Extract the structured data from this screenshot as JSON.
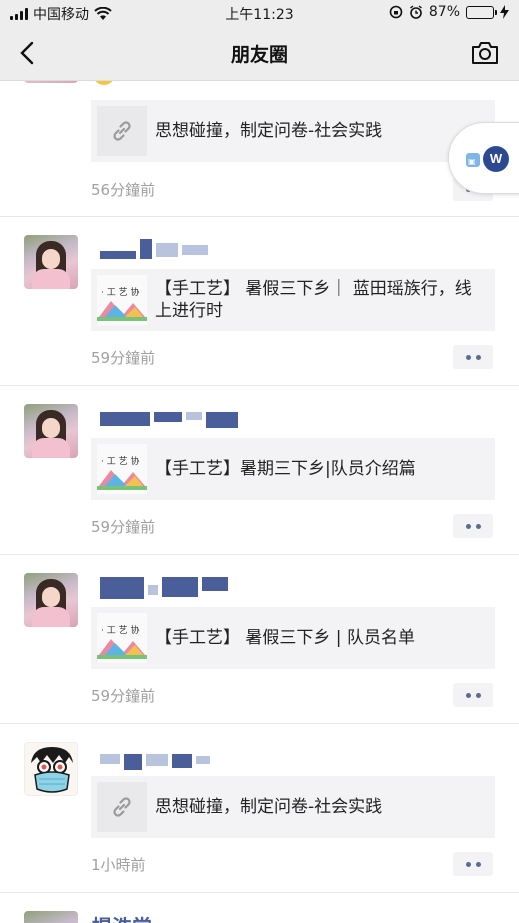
{
  "status_bar": {
    "carrier": "中国移动",
    "time": "上午11:23",
    "battery": "87%",
    "battery_level": 0.87
  },
  "nav": {
    "title": "朋友圈",
    "back_icon": "chevron-left-icon",
    "camera_icon": "camera-icon"
  },
  "posts": [
    {
      "share_text": "思想碰撞，制定问卷-社会实践",
      "time": "56分鐘前",
      "thumb": "link-icon"
    },
    {
      "share_text": "【手工艺】 暑假三下乡｜ 蓝田瑶族行，线上进行时",
      "time": "59分鐘前",
      "thumb": "手工艺协会"
    },
    {
      "share_text": "【手工艺】暑期三下乡|队员介绍篇",
      "time": "59分鐘前",
      "thumb": "手工艺协会"
    },
    {
      "share_text": "【手工艺】 暑假三下乡 | 队员名单",
      "time": "59分鐘前",
      "thumb": "手工艺协会"
    },
    {
      "share_text": "思想碰撞，制定问卷-社会实践",
      "time": "1小時前",
      "thumb": "link-icon"
    }
  ],
  "partial_name": "提浩常",
  "float_bubble": {
    "label": "W"
  },
  "colors": {
    "nav_bg": "#ededed",
    "link_blue": "#4a5f9a",
    "battery_green": "#4cd964"
  }
}
